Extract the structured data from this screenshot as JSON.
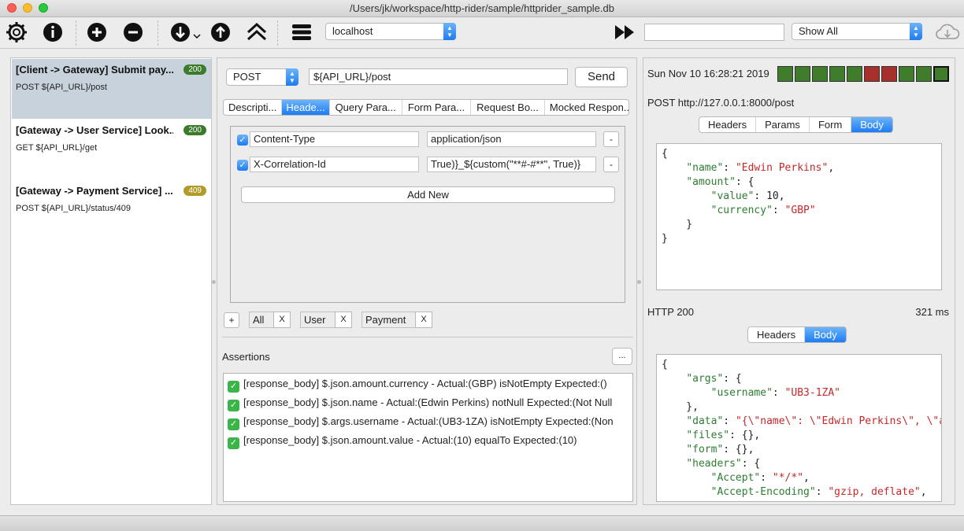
{
  "window": {
    "title": "/Users/jk/workspace/http-rider/sample/httprider_sample.db"
  },
  "toolbar": {
    "icons": [
      "gear-icon",
      "info-icon",
      "add-icon",
      "remove-icon",
      "download-icon",
      "upload-icon",
      "collapse-icon",
      "list-icon"
    ],
    "environment": "localhost",
    "run_icon": "fast-forward-icon",
    "search_value": "",
    "filter": "Show All",
    "cloud_icon": "cloud-download-icon"
  },
  "requests": [
    {
      "title": "[Client -> Gateway] Submit pay...",
      "subtitle": "POST ${API_URL}/post",
      "badge": "200",
      "badge_color": "#3c7a2c"
    },
    {
      "title": "[Gateway -> User Service] Look...",
      "subtitle": "GET ${API_URL}/get",
      "badge": "200",
      "badge_color": "#3c7a2c"
    },
    {
      "title": "[Gateway -> Payment Service] ...",
      "subtitle": "POST ${API_URL}/status/409",
      "badge": "409",
      "badge_color": "#b39b2b"
    }
  ],
  "editor": {
    "method": "POST",
    "url": "${API_URL}/post",
    "send_label": "Send",
    "tabs": [
      "Descripti...",
      "Heade...",
      "Query Para...",
      "Form Para...",
      "Request Bo...",
      "Mocked Respon..."
    ],
    "active_tab": 1,
    "headers": [
      {
        "name": "Content-Type",
        "value": "application/json",
        "checked": true
      },
      {
        "name": "X-Correlation-Id",
        "value": "True)}_${custom(\"**#-#**\", True)}",
        "checked": true
      }
    ],
    "remove_label": "-",
    "add_new_label": "Add New",
    "add_tag_label": "+",
    "tags": [
      "All",
      "User",
      "Payment"
    ],
    "tag_close_label": "X",
    "assertions_label": "Assertions",
    "assertions_more_label": "...",
    "assertions": [
      "[response_body] $.json.amount.currency - Actual:(GBP) isNotEmpty Expected:()",
      "[response_body] $.json.name - Actual:(Edwin Perkins) notNull Expected:(Not Null",
      "[response_body] $.args.username - Actual:(UB3-1ZA) isNotEmpty Expected:(Non",
      "[response_body] $.json.amount.value - Actual:(10) equalTo Expected:(10)"
    ]
  },
  "exchange": {
    "timestamp": "Sun Nov 10 16:28:21 2019",
    "history_colors": [
      "#3f7d2c",
      "#3f7d2c",
      "#3f7d2c",
      "#3f7d2c",
      "#3f7d2c",
      "#a8302c",
      "#a8302c",
      "#3f7d2c",
      "#3f7d2c",
      "#3f7d2c"
    ],
    "request_line": "POST http://127.0.0.1:8000/post",
    "request_tabs": [
      "Headers",
      "Params",
      "Form",
      "Body"
    ],
    "request_active_tab": 3,
    "request_body": [
      "{",
      "    \"name\": \"Edwin Perkins\",",
      "    \"amount\": {",
      "        \"value\": 10,",
      "        \"currency\": \"GBP\"",
      "    }",
      "}"
    ],
    "status": "HTTP 200",
    "elapsed": "321 ms",
    "response_tabs": [
      "Headers",
      "Body"
    ],
    "response_active_tab": 1,
    "response_body": [
      "{",
      "    \"args\": {",
      "        \"username\": \"UB3-1ZA\"",
      "    },",
      "    \"data\": \"{\\\"name\\\": \\\"Edwin Perkins\\\", \\\"a",
      "    \"files\": {},",
      "    \"form\": {},",
      "    \"headers\": {",
      "        \"Accept\": \"*/*\",",
      "        \"Accept-Encoding\": \"gzip, deflate\","
    ]
  }
}
